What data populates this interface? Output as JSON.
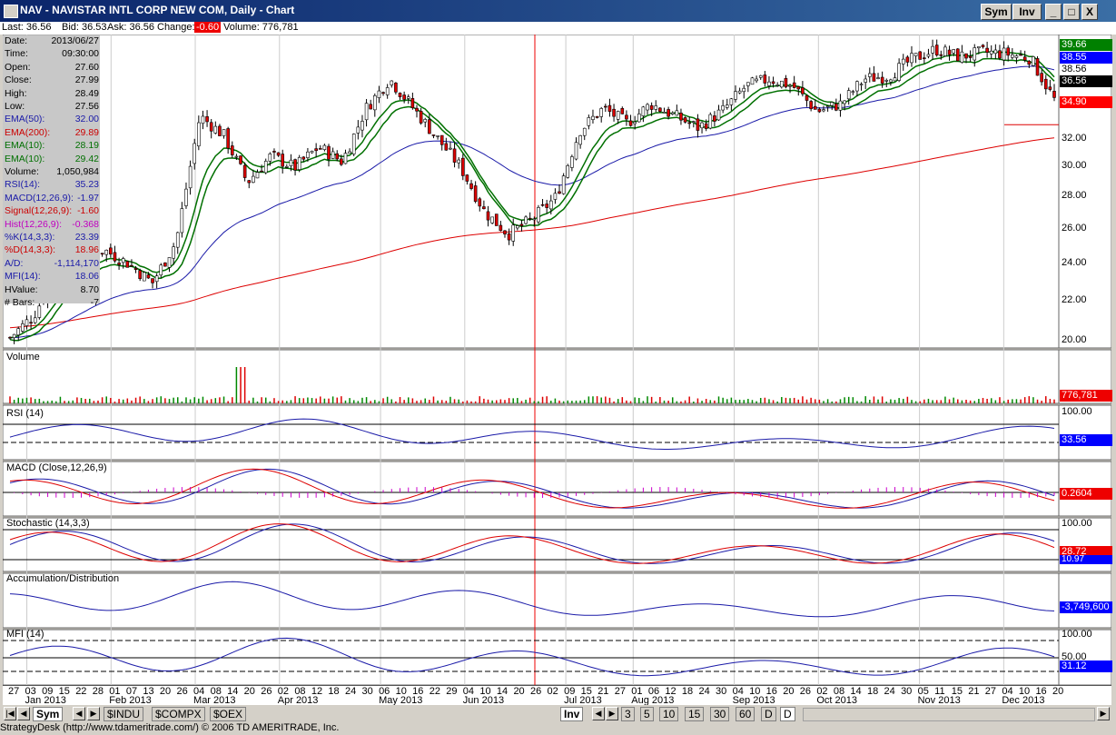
{
  "window": {
    "title": "NAV - NAVISTAR INTL CORP NEW COM, Daily - Chart",
    "sym_button": "Sym",
    "inv_button": "Inv",
    "min": "_",
    "max": "□",
    "close": "X"
  },
  "quote": {
    "last": "Last: 36.56",
    "bid": "Bid: 36.53",
    "ask": "Ask: 36.56",
    "change_label": "Change:",
    "change_value": "-0.60",
    "volume": "Volume: 776,781"
  },
  "data_window": [
    {
      "l": "Date:",
      "v": "2013/06/27",
      "c": "#000"
    },
    {
      "l": "Time:",
      "v": "09:30:00",
      "c": "#000"
    },
    {
      "l": "Open:",
      "v": "27.60",
      "c": "#000"
    },
    {
      "l": "Close:",
      "v": "27.99",
      "c": "#000"
    },
    {
      "l": "High:",
      "v": "28.49",
      "c": "#000"
    },
    {
      "l": "Low:",
      "v": "27.56",
      "c": "#000"
    },
    {
      "l": "EMA(50):",
      "v": "32.00",
      "c": "#1a1aa8"
    },
    {
      "l": "EMA(200):",
      "v": "29.89",
      "c": "#cc0000"
    },
    {
      "l": "EMA(10):",
      "v": "28.19",
      "c": "#007000"
    },
    {
      "l": "EMA(10):",
      "v": "29.42",
      "c": "#007000"
    },
    {
      "l": "Volume:",
      "v": "1,050,984",
      "c": "#000"
    },
    {
      "l": "RSI(14):",
      "v": "35.23",
      "c": "#1a1aa8"
    },
    {
      "l": "MACD(12,26,9):",
      "v": "-1.97",
      "c": "#1a1aa8"
    },
    {
      "l": "Signal(12,26,9):",
      "v": "-1.60",
      "c": "#cc0000"
    },
    {
      "l": "Hist(12,26,9):",
      "v": "-0.368",
      "c": "#c000c0"
    },
    {
      "l": "%K(14,3,3):",
      "v": "23.39",
      "c": "#1a1aa8"
    },
    {
      "l": "%D(14,3,3):",
      "v": "18.96",
      "c": "#cc0000"
    },
    {
      "l": "A/D:",
      "v": "-1,114,170",
      "c": "#1a1aa8"
    },
    {
      "l": "MFI(14):",
      "v": "18.06",
      "c": "#1a1aa8"
    },
    {
      "l": "HValue:",
      "v": "8.70",
      "c": "#000"
    },
    {
      "l": "# Bars:",
      "v": "-7",
      "c": "#000"
    }
  ],
  "price_pane": {
    "y_ticks": [
      "34.90",
      "32.00",
      "30.00",
      "28.00",
      "26.00",
      "24.00",
      "22.00",
      "20.00"
    ],
    "tags": [
      {
        "label": "39.66",
        "bg": "#008000",
        "fg": "#fff"
      },
      {
        "label": "38.55",
        "bg": "#0000ff",
        "fg": "#fff"
      },
      {
        "label": "38.56",
        "bg": "#ffffff",
        "fg": "#000"
      },
      {
        "label": "36.56",
        "bg": "#000000",
        "fg": "#fff"
      },
      {
        "label": "34.90",
        "bg": "#ff0000",
        "fg": "#fff"
      }
    ]
  },
  "panes": {
    "volume": {
      "title": "Volume",
      "tag": "776,781"
    },
    "rsi": {
      "title": "RSI (14)",
      "top": "100.00",
      "tag": "33.56"
    },
    "macd": {
      "title": "MACD (Close,12,26,9)",
      "tag": "0.2604"
    },
    "stoch": {
      "title": "Stochastic (14,3,3)",
      "top": "100.00",
      "tag_red": "28.72",
      "tag_blue": "10.97"
    },
    "ad": {
      "title": "Accumulation/Distribution",
      "tag": "-3,749,600"
    },
    "mfi": {
      "title": "MFI (14)",
      "top": "100.00",
      "mid": "50.00",
      "tag": "31.12"
    }
  },
  "x_axis": {
    "days": [
      "27",
      "03",
      "09",
      "15",
      "22",
      "28",
      "01",
      "07",
      "13",
      "20",
      "26",
      "04",
      "08",
      "14",
      "20",
      "26",
      "02",
      "08",
      "12",
      "18",
      "24",
      "30",
      "06",
      "10",
      "16",
      "22",
      "29",
      "04",
      "10",
      "14",
      "20",
      "26",
      "02",
      "09",
      "15",
      "21",
      "27",
      "01",
      "06",
      "12",
      "18",
      "24",
      "30",
      "04",
      "10",
      "16",
      "20",
      "26",
      "02",
      "08",
      "14",
      "18",
      "24",
      "30",
      "05",
      "11",
      "15",
      "21",
      "27",
      "04",
      "10",
      "16",
      "20"
    ],
    "months": [
      "Jan 2013",
      "Feb 2013",
      "Mar 2013",
      "Apr 2013",
      "May 2013",
      "Jun 2013",
      "Jul 2013",
      "Aug 2013",
      "Sep 2013",
      "Oct 2013",
      "Nov 2013",
      "Dec 2013"
    ]
  },
  "bottom_tabs": {
    "sym": "Sym",
    "tabs": [
      "$INDU",
      "$COMPX",
      "$OEX"
    ],
    "inv": "Inv",
    "periods": [
      "3",
      "5",
      "10",
      "15",
      "30",
      "60",
      "D",
      "D"
    ]
  },
  "status": "StrategyDesk (http://www.tdameritrade.com/) © 2006 TD AMERITRADE, Inc.",
  "chart_data": {
    "type": "candlestick",
    "title": "NAV - NAVISTAR INTL CORP NEW COM, Daily - Chart",
    "price_range": [
      19.8,
      41.0
    ],
    "cursor_date": "2013/06/27",
    "close_path_months": [
      "Jan",
      "Feb",
      "Mar",
      "Apr",
      "May",
      "Jun",
      "Jul",
      "Aug",
      "Sep",
      "Oct",
      "Nov",
      "Dec"
    ],
    "approx_closes": [
      20.5,
      22.0,
      25.0,
      26.0,
      26.4,
      25.5,
      24.2,
      27.0,
      35.5,
      34.2,
      31.0,
      32.8,
      32.0,
      33.4,
      32.4,
      36.0,
      38.0,
      36.0,
      34.0,
      32.0,
      29.0,
      27.5,
      28.5,
      30.0,
      34.5,
      36.0,
      35.0,
      36.3,
      35.5,
      34.7,
      35.8,
      37.5,
      38.0,
      37.5,
      35.8,
      36.3,
      38.0,
      38.2,
      39.3,
      40.0,
      39.5,
      39.8,
      39.7,
      39.4,
      36.6
    ]
  }
}
